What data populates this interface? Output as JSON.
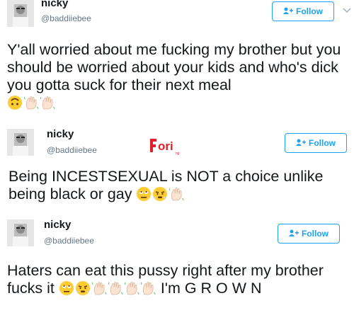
{
  "tweets": [
    {
      "name": "nicky",
      "handle": "@baddiiebee",
      "follow_label": "Follow",
      "text": "Y'all worried about me fucking my brother but you should be worried about your kids and who's dick you gotta suck for their next meal",
      "emojis": [
        "upside-down-face-emoji",
        "waving-hand-emoji",
        "waving-hand-emoji"
      ]
    },
    {
      "name": "nicky",
      "handle": "@baddiiebee",
      "follow_label": "Follow",
      "text": "Being INCESTSEXUAL is NOT a choice unlike being black or gay",
      "emojis": [
        "eye-roll-face-emoji",
        "steam-face-emoji",
        "waving-hand-emoji"
      ]
    },
    {
      "name": "nicky",
      "handle": "@baddiiebee",
      "follow_label": "Follow",
      "text_before": "Haters can eat this pussy right after my brother fucks it",
      "text_after": "I'm G R O W N",
      "emojis": [
        "eye-roll-face-emoji",
        "steam-face-emoji",
        "waving-hand-emoji",
        "waving-hand-emoji",
        "waving-hand-emoji",
        "waving-hand-emoji"
      ]
    }
  ],
  "watermark": {
    "text": "ori",
    "subtext": "ng"
  },
  "colors": {
    "twitter_blue": "#1da1f2",
    "text": "#14171a",
    "muted": "#657786",
    "watermark_red": "#e0202a"
  }
}
